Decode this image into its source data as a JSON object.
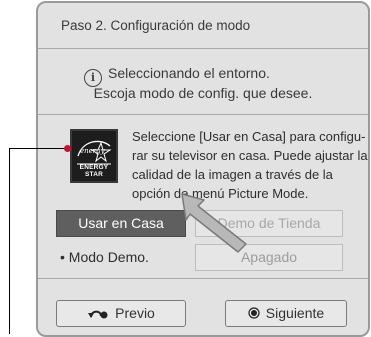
{
  "dialog": {
    "title": "Paso 2. Configuración de modo",
    "info_line1": "Seleccionando el entorno.",
    "info_line2": "Escoja modo de config. que desee.",
    "logo_text": "ENERGY STAR",
    "description": "Seleccione [Usar en Casa] para configu-rar su televisor en casa. Puede ajustar la calidad de la imagen a través de la opción de menú Picture Mode.",
    "desc_lines": [
      "Seleccione [Usar en Casa] para configu-",
      "rar su televisor en casa. Puede ajustar la",
      "calidad de la imagen a través de la",
      "opción de menú Picture Mode."
    ],
    "buttons": {
      "usar_en_casa": "Usar en Casa",
      "demo_de_tienda": "Demo de Tienda",
      "apagado": "Apagado",
      "previo": "Previo",
      "siguiente": "Siguiente"
    },
    "modo_demo": "• Modo Demo.",
    "icons": {
      "info": "info-icon",
      "previo": "back-arrow-icon",
      "siguiente": "radio-dot-icon",
      "logo": "energy-star-logo",
      "cursor": "pointer-cursor-icon"
    }
  },
  "colors": {
    "dialog_bg": "#e2e2e2",
    "selected_button": "#5f5f5f",
    "callout_dot": "#c8102e"
  }
}
